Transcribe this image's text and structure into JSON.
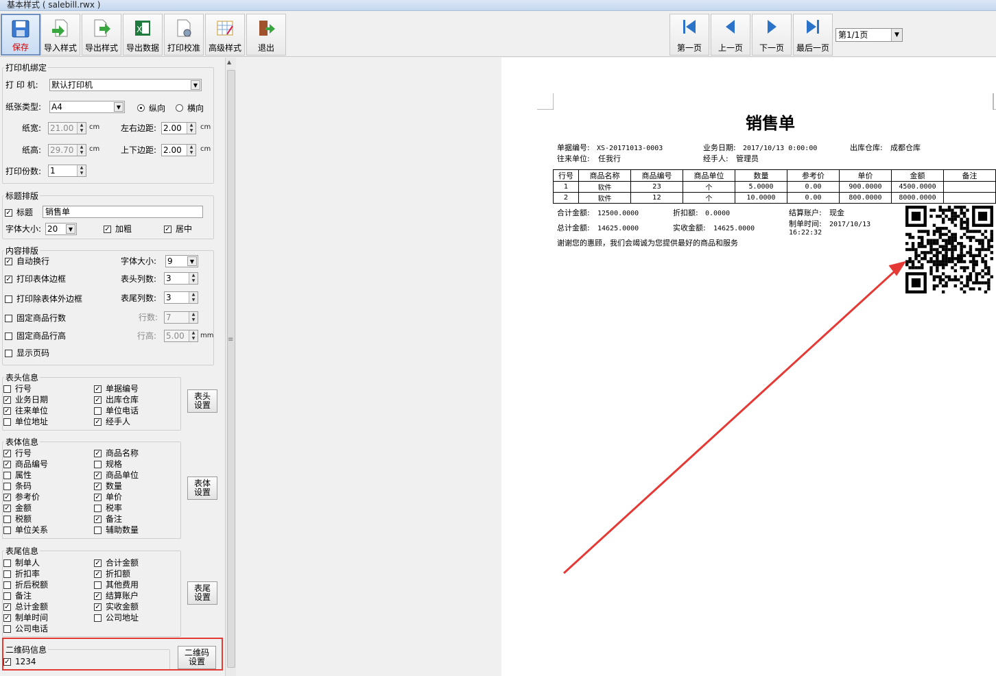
{
  "window": {
    "title": "基本样式 ( salebill.rwx )"
  },
  "toolbar": {
    "left": [
      {
        "label": "保存",
        "icon": "floppy-save-icon"
      },
      {
        "label": "导入样式",
        "icon": "import-style-icon"
      },
      {
        "label": "导出样式",
        "icon": "export-style-icon"
      },
      {
        "label": "导出数据",
        "icon": "excel-export-icon"
      },
      {
        "label": "打印校准",
        "icon": "print-calibrate-icon"
      },
      {
        "label": "高级样式",
        "icon": "advanced-style-icon"
      },
      {
        "label": "退出",
        "icon": "exit-door-icon"
      }
    ],
    "nav": [
      {
        "label": "第一页",
        "icon": "first-page-icon"
      },
      {
        "label": "上一页",
        "icon": "prev-page-icon"
      },
      {
        "label": "下一页",
        "icon": "next-page-icon"
      },
      {
        "label": "最后一页",
        "icon": "last-page-icon"
      }
    ],
    "page_select": "第1/1页"
  },
  "printer": {
    "legend": "打印机绑定",
    "printer_label": "打 印 机:",
    "printer_value": "默认打印机",
    "paper_label": "纸张类型:",
    "paper_value": "A4",
    "portrait": "纵向",
    "landscape": "横向",
    "orientation": "portrait",
    "width_label": "纸宽:",
    "width_value": "21.00",
    "height_label": "纸高:",
    "height_value": "29.70",
    "unit_cm": "cm",
    "lr_margin_label": "左右边距:",
    "lr_margin_value": "2.00",
    "tb_margin_label": "上下边距:",
    "tb_margin_value": "2.00",
    "copies_label": "打印份数:",
    "copies_value": "1"
  },
  "title_layout": {
    "legend": "标题排版",
    "title_label": "标题",
    "title_checked": true,
    "title_value": "销售单",
    "font_size_label": "字体大小:",
    "font_size_value": "20",
    "bold_label": "加粗",
    "bold_checked": true,
    "center_label": "居中",
    "center_checked": true
  },
  "content_layout": {
    "legend": "内容排版",
    "auto_wrap": {
      "label": "自动换行",
      "checked": true
    },
    "font_size_label": "字体大小:",
    "font_size_value": "9",
    "print_border": {
      "label": "打印表体边框",
      "checked": true
    },
    "header_cols_label": "表头列数:",
    "header_cols_value": "3",
    "print_no_outer": {
      "label": "打印除表体外边框",
      "checked": false
    },
    "footer_cols_label": "表尾列数:",
    "footer_cols_value": "3",
    "fixed_rows": {
      "label": "固定商品行数",
      "checked": false
    },
    "rows_label": "行数:",
    "rows_value": "7",
    "fixed_height": {
      "label": "固定商品行高",
      "checked": false
    },
    "row_height_label": "行高:",
    "row_height_value": "5.00",
    "unit_mm": "mm",
    "show_page": {
      "label": "显示页码",
      "checked": false
    }
  },
  "header_info": {
    "legend": "表头信息",
    "button": "表头\n设置",
    "items": [
      {
        "label": "行号",
        "checked": false
      },
      {
        "label": "单据编号",
        "checked": true
      },
      {
        "label": "业务日期",
        "checked": true
      },
      {
        "label": "出库仓库",
        "checked": true
      },
      {
        "label": "往来单位",
        "checked": true
      },
      {
        "label": "单位电话",
        "checked": false
      },
      {
        "label": "单位地址",
        "checked": false
      },
      {
        "label": "经手人",
        "checked": true
      }
    ]
  },
  "body_info": {
    "legend": "表体信息",
    "button": "表体\n设置",
    "items": [
      {
        "label": "行号",
        "checked": true
      },
      {
        "label": "商品名称",
        "checked": true
      },
      {
        "label": "商品编号",
        "checked": true
      },
      {
        "label": "规格",
        "checked": false
      },
      {
        "label": "属性",
        "checked": false
      },
      {
        "label": "商品单位",
        "checked": true
      },
      {
        "label": "条码",
        "checked": false
      },
      {
        "label": "数量",
        "checked": true
      },
      {
        "label": "参考价",
        "checked": true
      },
      {
        "label": "单价",
        "checked": true
      },
      {
        "label": "金额",
        "checked": true
      },
      {
        "label": "税率",
        "checked": false
      },
      {
        "label": "税额",
        "checked": false
      },
      {
        "label": "备注",
        "checked": true
      },
      {
        "label": "单位关系",
        "checked": false
      },
      {
        "label": "辅助数量",
        "checked": false
      }
    ]
  },
  "footer_info": {
    "legend": "表尾信息",
    "button": "表尾\n设置",
    "items": [
      {
        "label": "制单人",
        "checked": false
      },
      {
        "label": "合计金额",
        "checked": true
      },
      {
        "label": "折扣率",
        "checked": false
      },
      {
        "label": "折扣额",
        "checked": true
      },
      {
        "label": "折后税额",
        "checked": false
      },
      {
        "label": "其他费用",
        "checked": false
      },
      {
        "label": "备注",
        "checked": false
      },
      {
        "label": "结算账户",
        "checked": true
      },
      {
        "label": "总计金额",
        "checked": true
      },
      {
        "label": "实收金额",
        "checked": true
      },
      {
        "label": "制单时间",
        "checked": true
      },
      {
        "label": "公司地址",
        "checked": false
      },
      {
        "label": "公司电话",
        "checked": false
      }
    ]
  },
  "qr_info": {
    "legend": "二维码信息",
    "value": "1234",
    "checked": true,
    "button": "二维码\n设置"
  },
  "document": {
    "title": "销售单",
    "header": [
      {
        "label": "单据编号:",
        "value": "XS-20171013-0003"
      },
      {
        "label": "业务日期:",
        "value": "2017/10/13 0:00:00"
      },
      {
        "label": "出库仓库:",
        "value": "成都仓库"
      },
      {
        "label": "往来单位:",
        "value": "任我行"
      },
      {
        "label": "经手人:",
        "value": "管理员"
      }
    ],
    "columns": [
      "行号",
      "商品名称",
      "商品编号",
      "商品单位",
      "数量",
      "参考价",
      "单价",
      "金额",
      "备注"
    ],
    "rows": [
      [
        "1",
        "软件",
        "23",
        "个",
        "5.0000",
        "0.00",
        "900.0000",
        "4500.0000",
        ""
      ],
      [
        "2",
        "软件",
        "12",
        "个",
        "10.0000",
        "0.00",
        "800.0000",
        "8000.0000",
        ""
      ]
    ],
    "footer": {
      "sum_label": "合计金额:",
      "sum_value": "12500.0000",
      "discount_label": "折扣额:",
      "discount_value": "0.0000",
      "account_label": "结算账户:",
      "account_value": "现金",
      "total_label": "总计金额:",
      "total_value": "14625.0000",
      "received_label": "实收金额:",
      "received_value": "14625.0000",
      "time_label": "制单时间:",
      "time_value": "2017/10/13",
      "time_value2": "16:22:32",
      "thanks": "谢谢您的惠顾，我们会竭诚为您提供最好的商品和服务"
    }
  },
  "colors": {
    "annotation": "#e53935",
    "accent": "#2b73c8"
  }
}
